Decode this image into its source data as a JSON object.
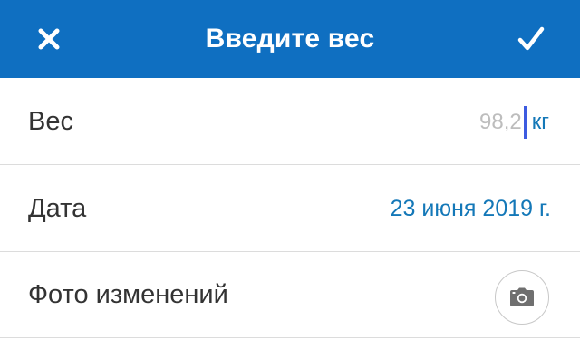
{
  "header": {
    "title": "Введите вес",
    "close_icon": "close-icon",
    "confirm_icon": "checkmark-icon",
    "background_color": "#0F6FC1"
  },
  "weight": {
    "label": "Вес",
    "value": "98,2",
    "unit": "кг"
  },
  "date": {
    "label": "Дата",
    "value": "23 июня 2019 г."
  },
  "photo": {
    "label": "Фото изменений",
    "icon": "camera-icon"
  },
  "colors": {
    "accent_text": "#1478B8",
    "caret": "#3D5BE0",
    "placeholder_text": "#BDBDBD"
  }
}
